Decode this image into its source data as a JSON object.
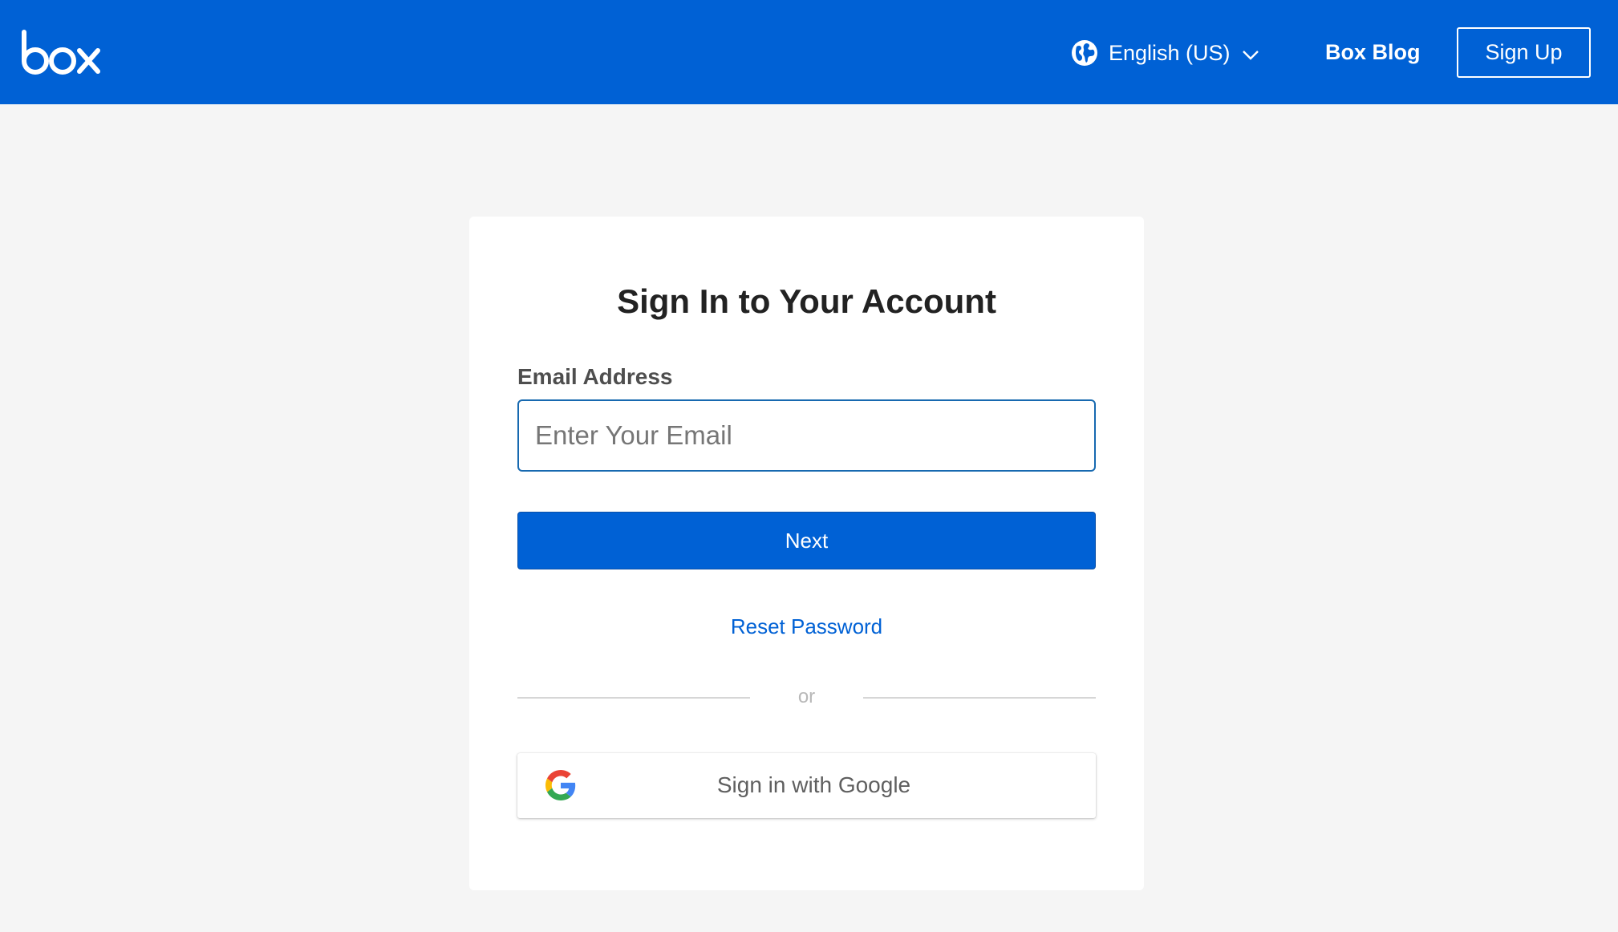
{
  "header": {
    "logo_text": "box",
    "language": {
      "label": "English (US)",
      "icon": "globe-icon"
    },
    "blog_link": "Box Blog",
    "signup_button": "Sign Up"
  },
  "login": {
    "title": "Sign In to Your Account",
    "email_label": "Email Address",
    "email_placeholder": "Enter Your Email",
    "email_value": "",
    "next_button": "Next",
    "reset_link": "Reset Password",
    "divider_text": "or",
    "google_button": "Sign in with Google",
    "google_icon": "google-logo-icon"
  },
  "colors": {
    "brand_blue": "#0061d5",
    "page_background": "#f5f5f5",
    "card_background": "#ffffff"
  }
}
